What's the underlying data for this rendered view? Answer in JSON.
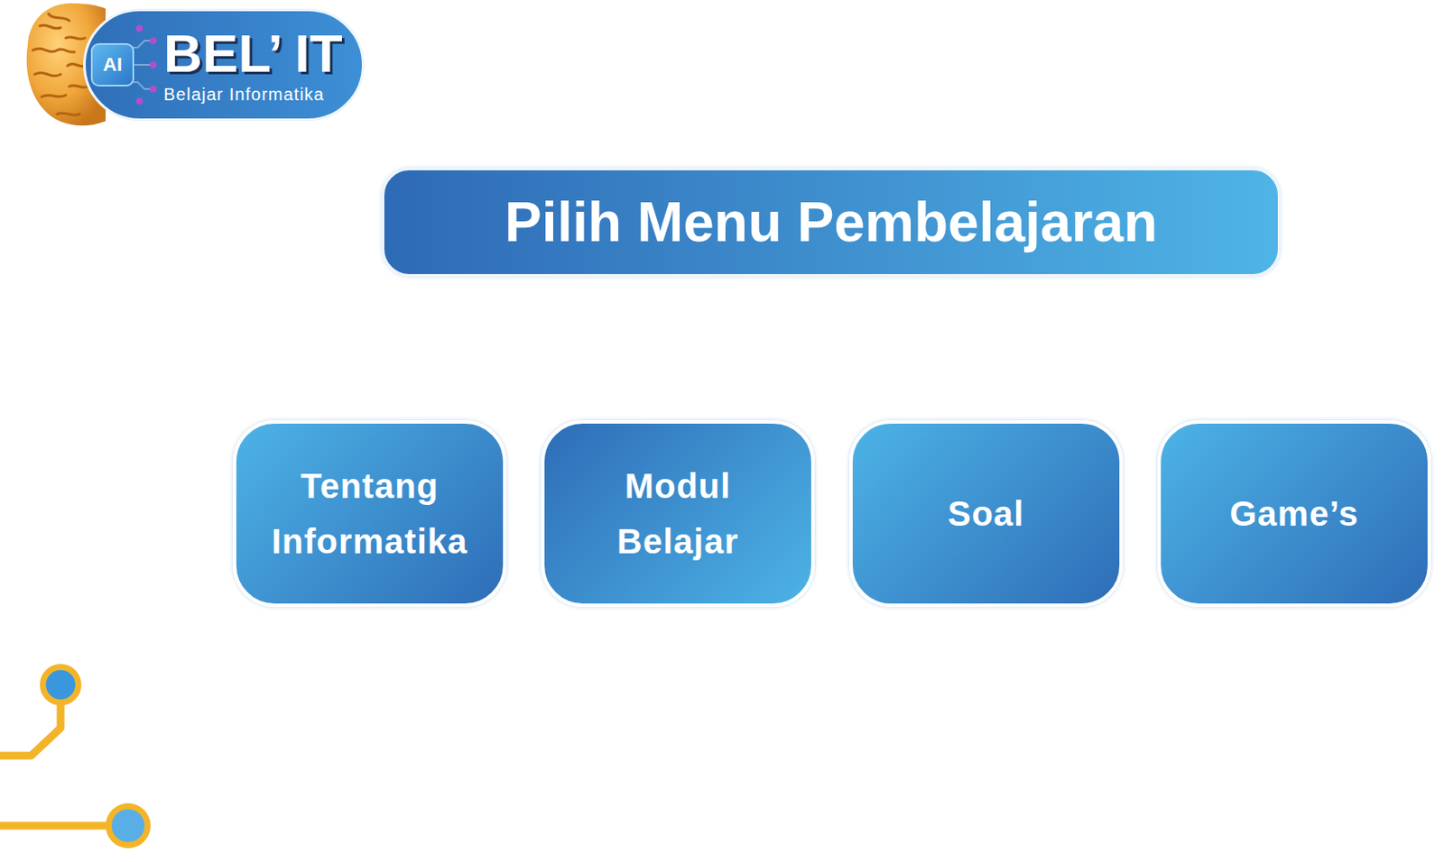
{
  "logo": {
    "badge": "AI",
    "title": "BEL’ IT",
    "subtitle": "Belajar Informatika"
  },
  "heading": "Pilih Menu Pembelajaran",
  "menu": [
    {
      "label": "Tentang Informatika"
    },
    {
      "label": "Modul Belajar"
    },
    {
      "label": "Soal"
    },
    {
      "label": "Game’s"
    }
  ]
}
